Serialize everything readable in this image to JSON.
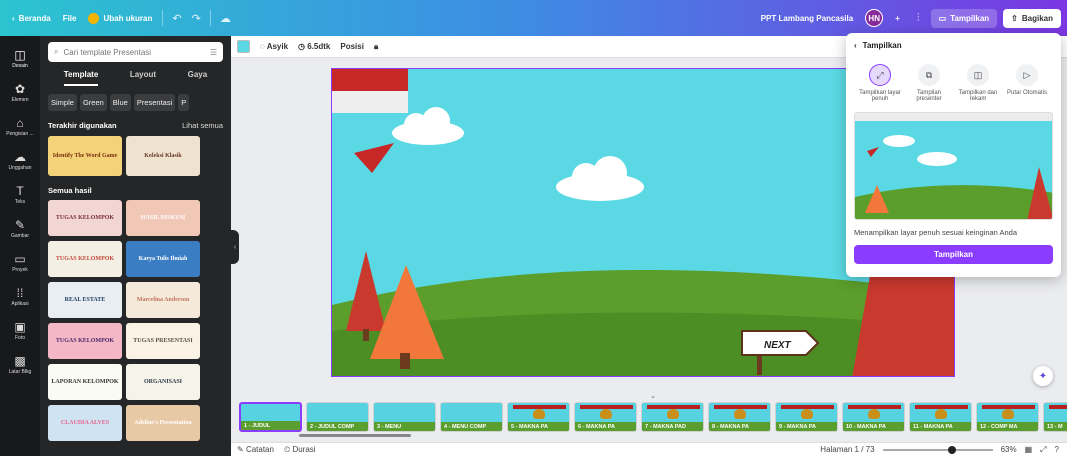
{
  "topbar": {
    "home": "Beranda",
    "file": "File",
    "resize": "Ubah ukuran",
    "doc_title": "PPT Lambang Pancasila",
    "avatar": "HN",
    "plus": "+",
    "present": "Tampilkan",
    "share": "Bagikan"
  },
  "rail": [
    {
      "label": "Desain",
      "icon": "layout-icon",
      "glyph": "◫"
    },
    {
      "label": "Elemen",
      "icon": "shapes-icon",
      "glyph": "✿"
    },
    {
      "label": "Pengisian ...",
      "icon": "brand-icon",
      "glyph": "⌂"
    },
    {
      "label": "Unggahan",
      "icon": "cloud-upload-icon",
      "glyph": "☁"
    },
    {
      "label": "Teks",
      "icon": "text-icon",
      "glyph": "T"
    },
    {
      "label": "Gambar",
      "icon": "draw-icon",
      "glyph": "✎"
    },
    {
      "label": "Proyek",
      "icon": "folder-icon",
      "glyph": "▭"
    },
    {
      "label": "Aplikasi",
      "icon": "apps-icon",
      "glyph": "⁞⁞"
    },
    {
      "label": "Foto",
      "icon": "photo-icon",
      "glyph": "▣"
    },
    {
      "label": "Latar Blkg",
      "icon": "background-icon",
      "glyph": "▩"
    }
  ],
  "panel": {
    "search_placeholder": "Cari template Presentasi",
    "tabs": [
      "Template",
      "Layout",
      "Gaya"
    ],
    "chips": [
      "Simple",
      "Green",
      "Blue",
      "Presentasi",
      "P"
    ],
    "recent_title": "Terakhir digunakan",
    "see_all": "Lihat semua",
    "recent": [
      {
        "text": "Identify The Word Game",
        "bg": "#f3d27a",
        "fg": "#7a2e0e"
      },
      {
        "text": "Koleksi Klasik",
        "bg": "#efe2cf",
        "fg": "#6b3b2a"
      }
    ],
    "all_title": "Semua hasil",
    "templates": [
      {
        "text": "TUGAS KELOMPOK",
        "bg": "#f2d6d3",
        "fg": "#7b2f3a"
      },
      {
        "text": "HASIL DISKUSI",
        "bg": "#f1c7b6",
        "fg": "#ffffff"
      },
      {
        "text": "TUGAS KELOMPOK",
        "bg": "#f4efe4",
        "fg": "#c24a3a"
      },
      {
        "text": "Karya Tulis Ilmiah",
        "bg": "#3a7dc2",
        "fg": "#ffffff"
      },
      {
        "text": "REAL ESTATE",
        "bg": "#e9eef3",
        "fg": "#1c3b5e"
      },
      {
        "text": "Marcelina Anderson",
        "bg": "#f5ead9",
        "fg": "#c0755e"
      },
      {
        "text": "TUGAS KELOMPOK",
        "bg": "#f3b7c5",
        "fg": "#4d2a6e"
      },
      {
        "text": "TUGAS PRESENTASI",
        "bg": "#faf3e5",
        "fg": "#5a4f44"
      },
      {
        "text": "LAPORAN KELOMPOK",
        "bg": "#fbfbf6",
        "fg": "#333333"
      },
      {
        "text": "ORGANISASI",
        "bg": "#f6f3ea",
        "fg": "#2f3a46"
      },
      {
        "text": "CLAUDIA ALVES",
        "bg": "#cfe3f3",
        "fg": "#e7628a"
      },
      {
        "text": "Adeline's Presentation",
        "bg": "#e8c9a6",
        "fg": "#ffffff"
      }
    ]
  },
  "editor": {
    "font": "Asyik",
    "duration": "6.5dtk",
    "position": "Posisi",
    "canvas_bg": "#5ad9e4"
  },
  "slide": {
    "next_label": "NEXT"
  },
  "filmstrip": [
    "1 - JUDUL",
    "2 - JUDUL COMP",
    "3 - MENU",
    "4 - MENU COMP",
    "5 - MAKNA PA",
    "6 - MAKNA PA",
    "7 - MAKNA PAD",
    "8 - MAKNA PA",
    "9 - MAKNA PA",
    "10 - MAKNA PA",
    "11 - MAKNA PA",
    "12 - COMP MA",
    "13 - M"
  ],
  "bottombar": {
    "notes": "Catatan",
    "duration": "Durasi",
    "page": "Halaman 1 / 73",
    "zoom_level": 0.63,
    "zoom": "63%",
    "help": "?"
  },
  "popover": {
    "title": "Tampilkan",
    "options": [
      {
        "label": "Tampilkan layar penuh",
        "icon": "fullscreen-icon",
        "glyph": "⤢"
      },
      {
        "label": "Tampilan presenter",
        "icon": "presenter-icon",
        "glyph": "⧉"
      },
      {
        "label": "Tampilkan dan rekam",
        "icon": "record-icon",
        "glyph": "◫"
      },
      {
        "label": "Putar Otomatis",
        "icon": "play-icon",
        "glyph": "▷"
      }
    ],
    "description": "Menampilkan layar penuh sesuai keinginan Anda",
    "button": "Tampilkan"
  },
  "colors": {
    "accent": "#8b3dff",
    "sky": "#5ad9e4",
    "grass": "#5b9e2c",
    "tree": "#f2773a"
  }
}
